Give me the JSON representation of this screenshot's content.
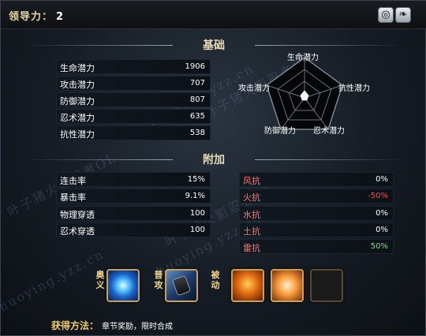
{
  "header": {
    "leadership_label": "领导力：",
    "leadership_value": "2"
  },
  "sections": {
    "base_title": "基础",
    "extra_title": "附加"
  },
  "base_stats": [
    {
      "label": "生命潜力",
      "value": "1906"
    },
    {
      "label": "攻击潜力",
      "value": "707"
    },
    {
      "label": "防御潜力",
      "value": "807"
    },
    {
      "label": "忍术潜力",
      "value": "635"
    },
    {
      "label": "抗性潜力",
      "value": "538"
    }
  ],
  "radar": {
    "axes": [
      "生命潜力",
      "抗性潜力",
      "忍术潜力",
      "防御潜力",
      "攻击潜力"
    ]
  },
  "extra_left": [
    {
      "label": "连击率",
      "value": "15%"
    },
    {
      "label": "暴击率",
      "value": "9.1%"
    },
    {
      "label": "物理穿透",
      "value": "100"
    },
    {
      "label": "忍术穿透",
      "value": "100"
    }
  ],
  "extra_right": [
    {
      "label": "风抗",
      "value": "0%"
    },
    {
      "label": "火抗",
      "value": "-50%"
    },
    {
      "label": "水抗",
      "value": "0%"
    },
    {
      "label": "土抗",
      "value": "0%"
    },
    {
      "label": "雷抗",
      "value": "50%"
    }
  ],
  "skills": {
    "ougi_label": "奥义",
    "normal_label": "普攻",
    "passive_label": "被动"
  },
  "obtain": {
    "label": "获得方法：",
    "text": "章节奖励，限时合成"
  },
  "watermarks": [
    "叶子猪火影忍者OL",
    "huoying.yzz.cn"
  ],
  "colors": {
    "gold": "#e9ddb6",
    "negative": "#ff4a4a",
    "positive": "#7fe07f"
  }
}
